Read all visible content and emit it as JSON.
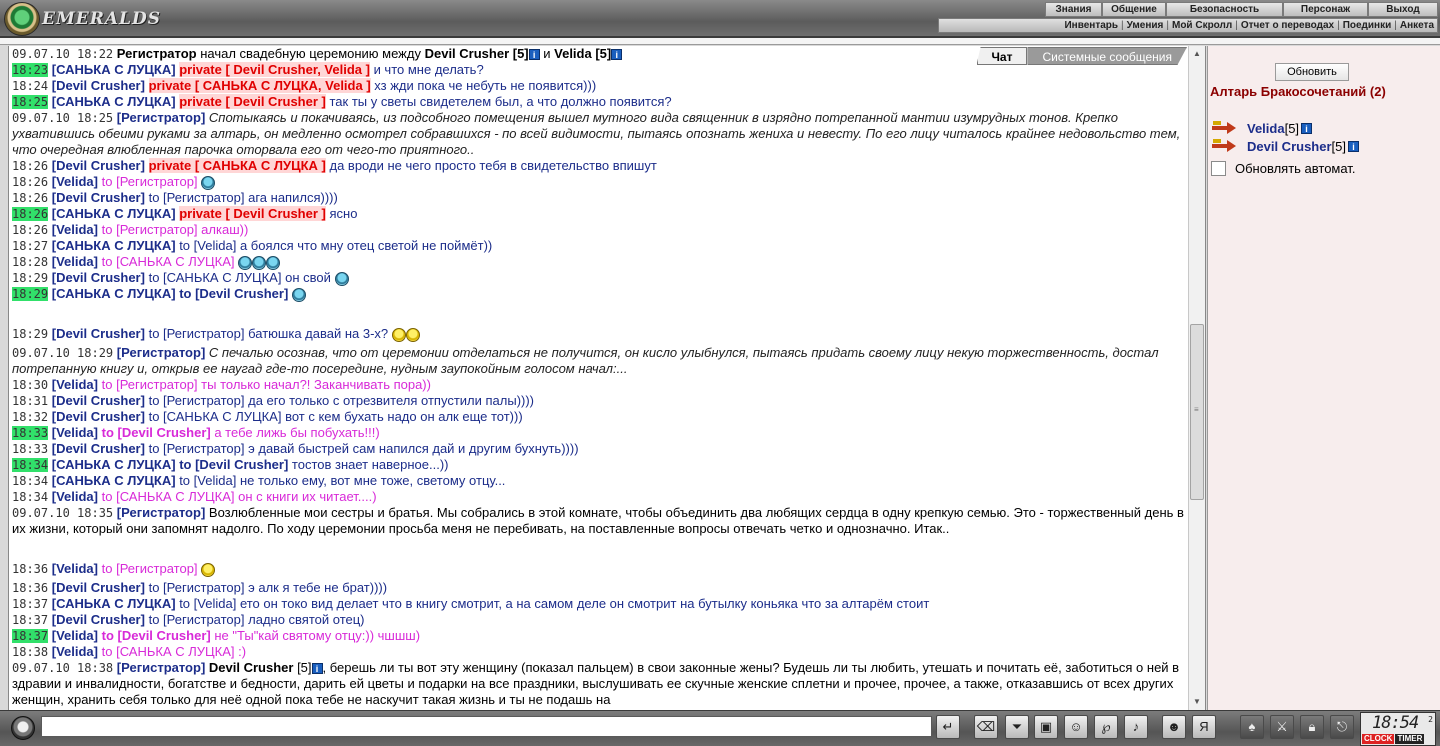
{
  "header": {
    "logo_text": "EMERALDS",
    "nav_row1": [
      "Знания",
      "Общение",
      "Безопасность",
      "Персонаж",
      "Выход"
    ],
    "nav_row2": [
      "Инвентарь",
      "Умения",
      "Мой Скролл",
      "Отчет о переводах",
      "Поединки",
      "Анкета"
    ]
  },
  "tabs": {
    "chat": "Чат",
    "system": "Системные сообщения"
  },
  "messages": [
    {
      "ts": "09.07.10 18:22",
      "hl": false,
      "who": "Регистратор",
      "who_class": "regname",
      "pre": "",
      "target": "",
      "text": "начал свадебную церемонию между ",
      "extra": "Devil Crusher [5]",
      "extra2": " и ",
      "extra3": "Velida [5]",
      "style": "plain",
      "info": true
    },
    {
      "ts": "18:23",
      "hl": true,
      "who": "[САНЬКА С ЛУЦКА]",
      "pre": "private",
      "target": "[ Devil Crusher, Velida ]",
      "text": "и что мне делать?",
      "style": "blue"
    },
    {
      "ts": "18:24",
      "hl": false,
      "who": "[Devil Crusher]",
      "pre": "private",
      "target": "[ САНЬКА С ЛУЦКА, Velida ]",
      "text": "хз жди пока че небуть не появится)))",
      "style": "blue"
    },
    {
      "ts": "18:25",
      "hl": true,
      "who": "[САНЬКА С ЛУЦКА]",
      "pre": "private",
      "target": "[ Devil Crusher ]",
      "text": "так ты у светы свидетелем был, а что должно появится?",
      "style": "blue"
    },
    {
      "ts": "09.07.10 18:25",
      "hl": false,
      "who": "[Регистратор]",
      "pre": "",
      "target": "",
      "text": "Спотыкаясь и покачиваясь, из подсобного помещения вышел мутного вида священник в изрядно потрепанной мантии изумрудных тонов. Крепко ухватившись обеими руками за алтарь, он медленно осмотрел собравшихся - по всей видимости, пытаясь опознать жениха и невесту. По его лицу читалось крайнее недовольство тем, что очередная влюбленная парочка оторвала его от чего-то приятного..",
      "style": "italic"
    },
    {
      "ts": "18:26",
      "hl": false,
      "who": "[Devil Crusher]",
      "pre": "private",
      "target": "[ САНЬКА С ЛУЦКА ]",
      "text": "да вроди не чего просто тебя в свидетельство впишут",
      "style": "blue"
    },
    {
      "ts": "18:26",
      "hl": false,
      "who": "[Velida]",
      "pre": "to",
      "target": "[Регистратор]",
      "text": "",
      "style": "pink",
      "smiles": 1
    },
    {
      "ts": "18:26",
      "hl": false,
      "who": "[Devil Crusher]",
      "pre": "to",
      "target": "[Регистратор]",
      "text": "ага напился))))",
      "style": "blue"
    },
    {
      "ts": "18:26",
      "hl": true,
      "who": "[САНЬКА С ЛУЦКА]",
      "pre": "private",
      "target": "[ Devil Crusher ]",
      "text": "ясно",
      "style": "blue"
    },
    {
      "ts": "18:26",
      "hl": false,
      "who": "[Velida]",
      "pre": "to",
      "target": "[Регистратор]",
      "text": "алкаш))",
      "style": "pink"
    },
    {
      "ts": "18:27",
      "hl": false,
      "who": "[САНЬКА С ЛУЦКА]",
      "pre": "to",
      "target": "[Velida]",
      "text": "а боялся что мну отец светой не поймёт))",
      "style": "blue"
    },
    {
      "ts": "18:28",
      "hl": false,
      "who": "[Velida]",
      "pre": "to",
      "target": "[САНЬКА С ЛУЦКА]",
      "text": "",
      "style": "pink",
      "smiles": 3
    },
    {
      "ts": "18:29",
      "hl": false,
      "who": "[Devil Crusher]",
      "pre": "to",
      "target": "[САНЬКА С ЛУЦКА]",
      "text": "он свой",
      "style": "blue",
      "smiles": 1
    },
    {
      "ts": "18:29",
      "hl": true,
      "who": "[САНЬКА С ЛУЦКА]",
      "pre": "to-bold",
      "target": "[Devil Crusher]",
      "text": "",
      "style": "blue",
      "smiles": 1
    },
    {
      "ts": "18:29",
      "hl": false,
      "who": "[Devil Crusher]",
      "pre": "to",
      "target": "[Регистратор]",
      "text": "батюшка давай на 3-х?",
      "style": "blue",
      "smiles": 2,
      "yellow": true,
      "tall": true
    },
    {
      "ts": "09.07.10 18:29",
      "hl": false,
      "who": "[Регистратор]",
      "pre": "",
      "target": "",
      "text": "С печалью осознав, что от церемонии отделаться не получится, он кисло улыбнулся, пытаясь придать своему лицу некую торжественность, достал потрепанную книгу и, открыв ее наугад где-то посередине, нудным заупокойным голосом начал:...",
      "style": "italic"
    },
    {
      "ts": "18:30",
      "hl": false,
      "who": "[Velida]",
      "pre": "to",
      "target": "[Регистратор]",
      "text": "ты только начал?! Заканчивать пора))",
      "style": "pink"
    },
    {
      "ts": "18:31",
      "hl": false,
      "who": "[Devil Crusher]",
      "pre": "to",
      "target": "[Регистратор]",
      "text": "да его только с отрезвителя отпустили палы))))",
      "style": "blue"
    },
    {
      "ts": "18:32",
      "hl": false,
      "who": "[Devil Crusher]",
      "pre": "to",
      "target": "[САНЬКА С ЛУЦКА]",
      "text": "вот с кем бухать надо он алк еще тот)))",
      "style": "blue"
    },
    {
      "ts": "18:33",
      "hl": true,
      "who": "[Velida]",
      "pre": "to-bold",
      "target": "[Devil Crusher]",
      "text": "а тебе лижь бы побухать!!!)",
      "style": "pink"
    },
    {
      "ts": "18:33",
      "hl": false,
      "who": "[Devil Crusher]",
      "pre": "to",
      "target": "[Регистратор]",
      "text": "э давай быстрей сам напился дай и другим бухнуть))))",
      "style": "blue"
    },
    {
      "ts": "18:34",
      "hl": true,
      "who": "[САНЬКА С ЛУЦКА]",
      "pre": "to-bold",
      "target": "[Devil Crusher]",
      "text": "тостов знает наверное...))",
      "style": "blue"
    },
    {
      "ts": "18:34",
      "hl": false,
      "who": "[САНЬКА С ЛУЦКА]",
      "pre": "to",
      "target": "[Velida]",
      "text": "не только ему, вот мне тоже, светому отцу...",
      "style": "blue"
    },
    {
      "ts": "18:34",
      "hl": false,
      "who": "[Velida]",
      "pre": "to",
      "target": "[САНЬКА С ЛУЦКА]",
      "text": "он с книги их читает....)",
      "style": "pink"
    },
    {
      "ts": "09.07.10 18:35",
      "hl": false,
      "who": "[Регистратор]",
      "pre": "",
      "target": "",
      "text": "Возлюбленные мои сестры и братья. Мы собрались в этой комнате, чтобы объединить два любящих сердца в одну крепкую семью. Это - торжественный день в их жизни, который они запомнят надолго. По ходу церемонии просьба меня не перебивать, на поставленные вопросы отвечать четко и однозначно. Итак..",
      "style": "plain"
    },
    {
      "ts": "18:36",
      "hl": false,
      "who": "[Velida]",
      "pre": "to",
      "target": "[Регистратор]",
      "text": "",
      "style": "pink",
      "smiles": 1,
      "yellow": true,
      "tall": true
    },
    {
      "ts": "18:36",
      "hl": false,
      "who": "[Devil Crusher]",
      "pre": "to",
      "target": "[Регистратор]",
      "text": "э алк я тебе не брат))))",
      "style": "blue"
    },
    {
      "ts": "18:37",
      "hl": false,
      "who": "[САНЬКА С ЛУЦКА]",
      "pre": "to",
      "target": "[Velida]",
      "text": "ето он токо вид делает что в книгу смотрит, а на самом деле он смотрит на бутылку коньяка что за алтарём стоит",
      "style": "blue"
    },
    {
      "ts": "18:37",
      "hl": false,
      "who": "[Devil Crusher]",
      "pre": "to",
      "target": "[Регистратор]",
      "text": "ладно святой отец)",
      "style": "blue"
    },
    {
      "ts": "18:37",
      "hl": true,
      "who": "[Velida]",
      "pre": "to-bold",
      "target": "[Devil Crusher]",
      "text": "не \"Ты\"кай святому отцу:)) чшшш)",
      "style": "pink"
    },
    {
      "ts": "18:38",
      "hl": false,
      "who": "[Velida]",
      "pre": "to",
      "target": "[САНЬКА С ЛУЦКА]",
      "text": ":)",
      "style": "pink"
    },
    {
      "ts": "09.07.10 18:38",
      "hl": false,
      "who": "[Регистратор]",
      "pre": "",
      "target": "",
      "text": ", берешь ли ты вот эту женщину (показал пальцем) в свои законные жены? Будешь ли ты любить, утешать и почитать её, заботиться о ней в здравии и инвалидности, богатстве и бедности, дарить ей цветы и подарки на все праздники, выслушивать ее скучные женские сплетни и прочее, прочее, а также, отказавшись от всех других женщин, хранить себя только для неё одной пока тебе не наскучит такая жизнь и ты не подашь на",
      "style": "plain",
      "extra": "Devil Crusher",
      "extra_lvl": " [5]",
      "info": true
    }
  ],
  "side": {
    "refresh_label": "Обновить",
    "room_title": "Алтарь Бракосочетаний (2)",
    "users": [
      {
        "name": "Velida",
        "level": "[5]"
      },
      {
        "name": "Devil Crusher",
        "level": "[5]"
      }
    ],
    "auto_label": "Обновлять автомат."
  },
  "footer": {
    "input_value": "",
    "clock_time": "18:54",
    "clock_sec": "2",
    "clock_btn": "CLOCK",
    "timer_btn": "TIMER"
  },
  "colors": {
    "highlight": "#31e06a",
    "nick_blue": "#1c2d8a",
    "private_red": "#e00000",
    "pink": "#d82ad8",
    "room_title": "#8b0000"
  }
}
